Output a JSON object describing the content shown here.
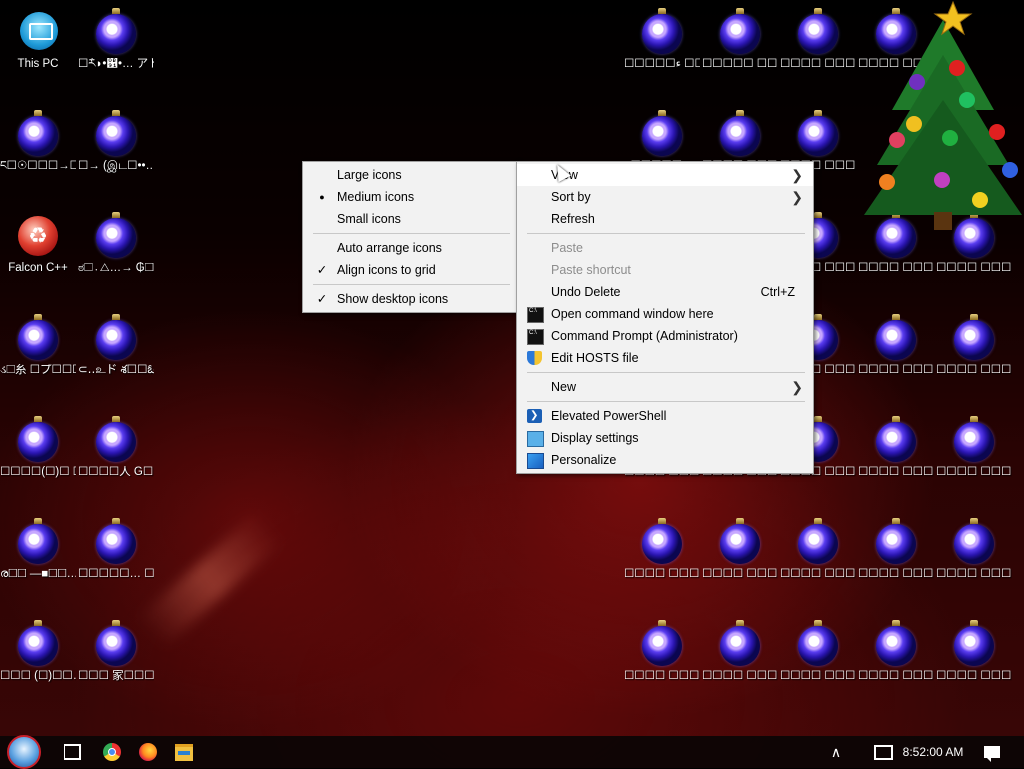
{
  "desktop_icons": [
    {
      "label": "This PC",
      "icon": "this-pc-icon"
    },
    {
      "label": "☐རོི◗•஑•… アト☐ϸ☐☐☉",
      "icon": "ornament-icon"
    },
    {
      "label": "ང☐☉☐☐☐→☐",
      "icon": "ornament-icon"
    },
    {
      "label": "☐→ (இட☐••…",
      "icon": "ornament-icon"
    },
    {
      "label": "Falcon C++",
      "icon": "falcon-icon"
    },
    {
      "label": "ಠ☐․△…→ ₲☐☐☐☐…",
      "icon": "ornament-icon"
    },
    {
      "label": "ડ☐糸 ☐プ☐☐☐…",
      "icon": "ornament-icon"
    },
    {
      "label": "⊂․․உド శ☐☐ఓ☐…",
      "icon": "ornament-icon"
    },
    {
      "label": "☐☐☐☐(☐)☐ ☐(☐)☐☐☐…",
      "icon": "ornament-icon"
    },
    {
      "label": "☐☐☐☐人 G☐☐←☐…",
      "icon": "ornament-icon"
    },
    {
      "label": "ര☐☐ —■☐☐…",
      "icon": "ornament-icon"
    },
    {
      "label": "☐☐☐☐☐… ☐☐☐☐…",
      "icon": "ornament-icon"
    },
    {
      "label": "☐☐☐ (☐)☐☐…",
      "icon": "ornament-icon"
    },
    {
      "label": "☐☐☐ 家☐☐☐…",
      "icon": "ornament-icon"
    },
    {
      "label": "☐☐☐☐☐ء ☐☐☐☐☐",
      "icon": "ornament-icon"
    },
    {
      "label": "☐☐☐☐☐ ☐☐☐☐…",
      "icon": "ornament-icon"
    },
    {
      "label": "☐☐☐☐ ☐☐☐☐…",
      "icon": "ornament-icon"
    },
    {
      "label": "☐☐☐☐ ☐☐☐☐…",
      "icon": "ornament-icon"
    },
    {
      "label": "☐☐☐☐☐…",
      "icon": "ornament-icon"
    },
    {
      "label": "☐☐☐☐ ☐☐☐☐…",
      "icon": "ornament-icon"
    },
    {
      "label": "☐☐☐☐ ☐☐☐☐…",
      "icon": "ornament-icon"
    },
    {
      "label": "☐☐☐☐ ☐☐☐☐…",
      "icon": "ornament-icon"
    },
    {
      "label": "☐☐☐☐ ☐☐☐☐…",
      "icon": "ornament-icon"
    },
    {
      "label": "☐☐☐☐ ☐☐☐☐…",
      "icon": "ornament-icon"
    },
    {
      "label": "☐☐☐☐ ☐☐☐☐…",
      "icon": "ornament-icon"
    },
    {
      "label": "☐☐☐☐ ☐☐☐☐…",
      "icon": "ornament-icon"
    },
    {
      "label": "☐☐☐☐ ☐☐☐☐…",
      "icon": "ornament-icon"
    },
    {
      "label": "☐☐☐☐ ☐☐☐☐…",
      "icon": "ornament-icon"
    },
    {
      "label": "☐☐☐☐ ☐☐☐☐…",
      "icon": "ornament-icon"
    },
    {
      "label": "☐☐☐☐ ☐☐☐☐…",
      "icon": "ornament-icon"
    },
    {
      "label": "☐☐☐☐ ☐☐☐☐…",
      "icon": "ornament-icon"
    },
    {
      "label": "☐☐☐☐ ☐☐☐☐…",
      "icon": "ornament-icon"
    },
    {
      "label": "☐☐☐☐ ☐☐☐☐…",
      "icon": "ornament-icon"
    },
    {
      "label": "☐☐☐☐ ☐☐☐☐…",
      "icon": "ornament-icon"
    },
    {
      "label": "☐☐☐☐ ☐☐☐☐…",
      "icon": "ornament-icon"
    },
    {
      "label": "☐☐☐☐ ☐☐☐☐…",
      "icon": "ornament-icon"
    },
    {
      "label": "☐☐☐☐ ☐☐☐☐…",
      "icon": "ornament-icon"
    },
    {
      "label": "☐☐☐☐ ☐☐☐☐…",
      "icon": "ornament-icon"
    },
    {
      "label": "☐☐☐☐ ☐☐☐☐…",
      "icon": "ornament-icon"
    },
    {
      "label": "☐☐☐☐ ☐☐☐☐…",
      "icon": "ornament-icon"
    },
    {
      "label": "☐☐☐☐ ☐☐☐☐…",
      "icon": "ornament-icon"
    },
    {
      "label": "☐☐☐☐ ☐☐☐☐…",
      "icon": "ornament-icon"
    },
    {
      "label": "☐☐☐☐ ☐☐☐☐…",
      "icon": "ornament-icon"
    },
    {
      "label": "☐☐☐☐ ☐☐☐☐…",
      "icon": "ornament-icon"
    },
    {
      "label": "☐☐☐☐ ☐☐☐☐…",
      "icon": "ornament-icon"
    },
    {
      "label": "☐☐☐☐ ☐☐☐☐…",
      "icon": "ornament-icon"
    },
    {
      "label": "☐☐☐☐ ☐☐☐☐…",
      "icon": "ornament-icon"
    },
    {
      "label": "☐☐☐☐ ☐☐☐☐…",
      "icon": "ornament-icon"
    }
  ],
  "view_submenu": {
    "items": [
      {
        "label": "Large icons",
        "mark": ""
      },
      {
        "label": "Medium icons",
        "mark": "●"
      },
      {
        "label": "Small icons",
        "mark": ""
      },
      {
        "label": "Auto arrange icons",
        "mark": ""
      },
      {
        "label": "Align icons to grid",
        "mark": "✓"
      },
      {
        "label": "Show desktop icons",
        "mark": "✓"
      }
    ]
  },
  "context_menu": {
    "view_label": "View",
    "sort_by_label": "Sort by",
    "refresh_label": "Refresh",
    "paste_label": "Paste",
    "paste_shortcut_label": "Paste shortcut",
    "undo_delete_label": "Undo Delete",
    "undo_delete_shortcut": "Ctrl+Z",
    "open_cmd_label": "Open command window here",
    "cmd_admin_label": "Command Prompt (Administrator)",
    "edit_hosts_label": "Edit HOSTS file",
    "new_label": "New",
    "elevated_ps_label": "Elevated PowerShell",
    "display_settings_label": "Display settings",
    "personalize_label": "Personalize",
    "submenu_arrow": "❯"
  },
  "taskbar": {
    "chevron": "∧",
    "time": "8:52:00 AM"
  },
  "colors": {
    "menu_bg": "#f2f2f2",
    "highlight": "#ffffff",
    "disabled_text": "#8d8d8d",
    "taskbar_bg": "#0a0505"
  }
}
